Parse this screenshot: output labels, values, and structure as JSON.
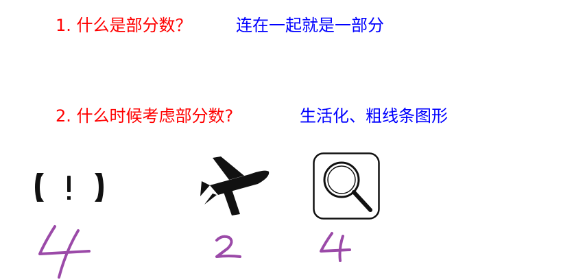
{
  "questions": [
    {
      "question": "1. 什么是部分数？",
      "answer": "连在一起就是一部分"
    },
    {
      "question": "2. 什么时候考虑部分数?",
      "answer": "生活化、粗线条图形"
    }
  ],
  "examples": [
    {
      "symbol": "【！】",
      "icon": "exclamation-brackets-icon",
      "count": 4
    },
    {
      "icon": "airplane-icon",
      "count": 2
    },
    {
      "icon": "magnifier-icon",
      "count": 4
    }
  ],
  "colors": {
    "question": "#ff0000",
    "answer": "#0000ff",
    "handwriting": "#9b4aa8",
    "icon": "#111111"
  }
}
